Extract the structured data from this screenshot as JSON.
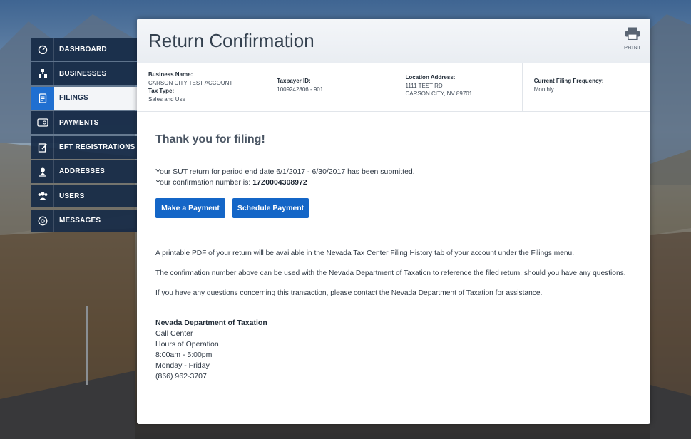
{
  "sidebar": {
    "items": [
      {
        "label": "DASHBOARD",
        "icon": "dashboard-icon"
      },
      {
        "label": "BUSINESSES",
        "icon": "businesses-icon"
      },
      {
        "label": "FILINGS",
        "icon": "filings-icon"
      },
      {
        "label": "PAYMENTS",
        "icon": "payments-icon"
      },
      {
        "label": "EFT REGISTRATIONS",
        "icon": "eft-icon"
      },
      {
        "label": "ADDRESSES",
        "icon": "addresses-icon"
      },
      {
        "label": "USERS",
        "icon": "users-icon"
      },
      {
        "label": "MESSAGES",
        "icon": "messages-icon"
      }
    ],
    "active_index": 2
  },
  "header": {
    "title": "Return Confirmation",
    "print_label": "PRINT"
  },
  "info": {
    "business_name_label": "Business Name:",
    "business_name": "CARSON CITY TEST ACCOUNT",
    "tax_type_label": "Tax Type:",
    "tax_type": "Sales and Use",
    "taxpayer_id_label": "Taxpayer ID:",
    "taxpayer_id": "1009242806 - 901",
    "location_label": "Location Address:",
    "location_line1": "1111 TEST RD",
    "location_line2": "CARSON CITY, NV 89701",
    "frequency_label": "Current Filing Frequency:",
    "frequency": "Monthly"
  },
  "main": {
    "thanks": "Thank you for filing!",
    "submitted_line": "Your SUT return for period end date 6/1/2017 - 6/30/2017 has been submitted.",
    "confirmation_prefix": "Your confirmation number is:",
    "confirmation_number": "17Z0004308972",
    "make_payment_label": "Make a Payment",
    "schedule_payment_label": "Schedule Payment",
    "para1": "A printable PDF of your return will be available in the Nevada Tax Center Filing History tab of your account under the Filings menu.",
    "para2": "The confirmation number above can be used with the Nevada Department of Taxation to reference the filed return, should you have any questions.",
    "para3": "If you have any questions concerning this transaction, please contact the Nevada Department of Taxation for assistance."
  },
  "contact": {
    "org": "Nevada Department of Taxation",
    "line1": "Call Center",
    "line2": "Hours of Operation",
    "line3": "8:00am - 5:00pm",
    "line4": "Monday - Friday",
    "line5": "(866) 962-3707"
  },
  "colors": {
    "accent": "#1466c7",
    "sidebar_bg": "#162a46",
    "active_icon_bg": "#1f6fd1"
  }
}
